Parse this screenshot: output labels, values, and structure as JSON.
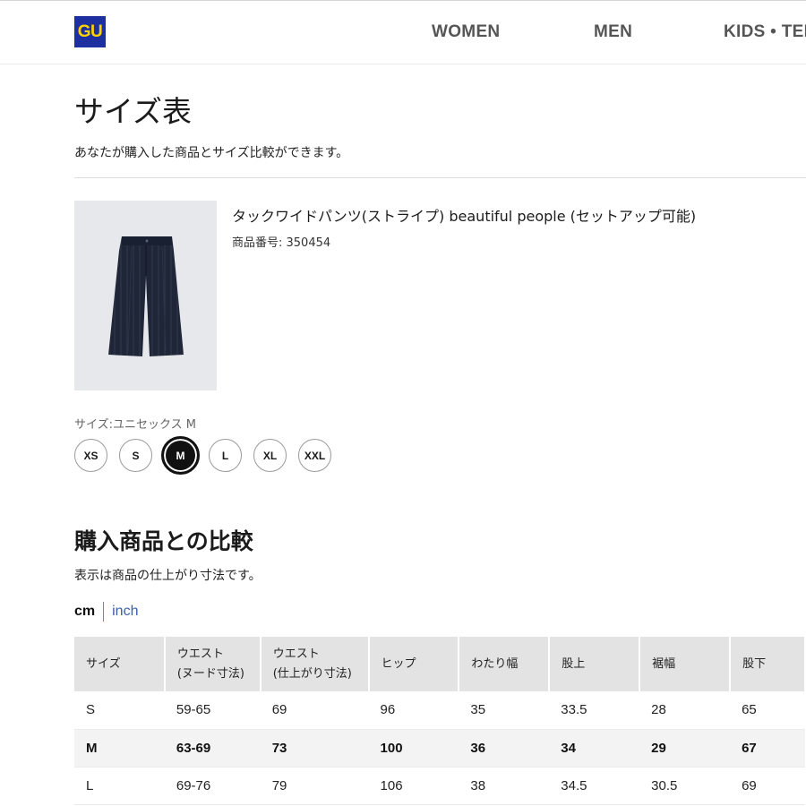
{
  "header": {
    "logo_text": "GU",
    "nav": [
      "WOMEN",
      "MEN",
      "KIDS • TEE"
    ]
  },
  "page": {
    "title": "サイズ表",
    "subtitle": "あなたが購入した商品とサイズ比較ができます。"
  },
  "product": {
    "name": "タックワイドパンツ(ストライプ) beautiful people (セットアップ可能)",
    "id_label": "商品番号: 350454"
  },
  "size_selector": {
    "label": "サイズ:ユニセックス M",
    "options": [
      "XS",
      "S",
      "M",
      "L",
      "XL",
      "XXL"
    ],
    "selected": "M"
  },
  "comparison": {
    "title": "購入商品との比較",
    "subtitle": "表示は商品の仕上がり寸法です。",
    "units": {
      "active": "cm",
      "other": "inch"
    }
  },
  "table": {
    "headers": [
      [
        "サイズ"
      ],
      [
        "ウエスト",
        "(ヌード寸法)"
      ],
      [
        "ウエスト",
        "(仕上がり寸法)"
      ],
      [
        "ヒップ"
      ],
      [
        "わたり幅"
      ],
      [
        "股上"
      ],
      [
        "裾幅"
      ],
      [
        "股下"
      ]
    ],
    "rows": [
      [
        "S",
        "59-65",
        "69",
        "96",
        "35",
        "33.5",
        "28",
        "65"
      ],
      [
        "M",
        "63-69",
        "73",
        "100",
        "36",
        "34",
        "29",
        "67"
      ],
      [
        "L",
        "69-76",
        "79",
        "106",
        "38",
        "34.5",
        "30.5",
        "69"
      ]
    ],
    "selected_row": "M"
  },
  "colors": {
    "logo_bg": "#1e2fa0",
    "logo_text": "#ffd200",
    "link": "#3b5fae",
    "header_cell": "#e3e3e3"
  }
}
